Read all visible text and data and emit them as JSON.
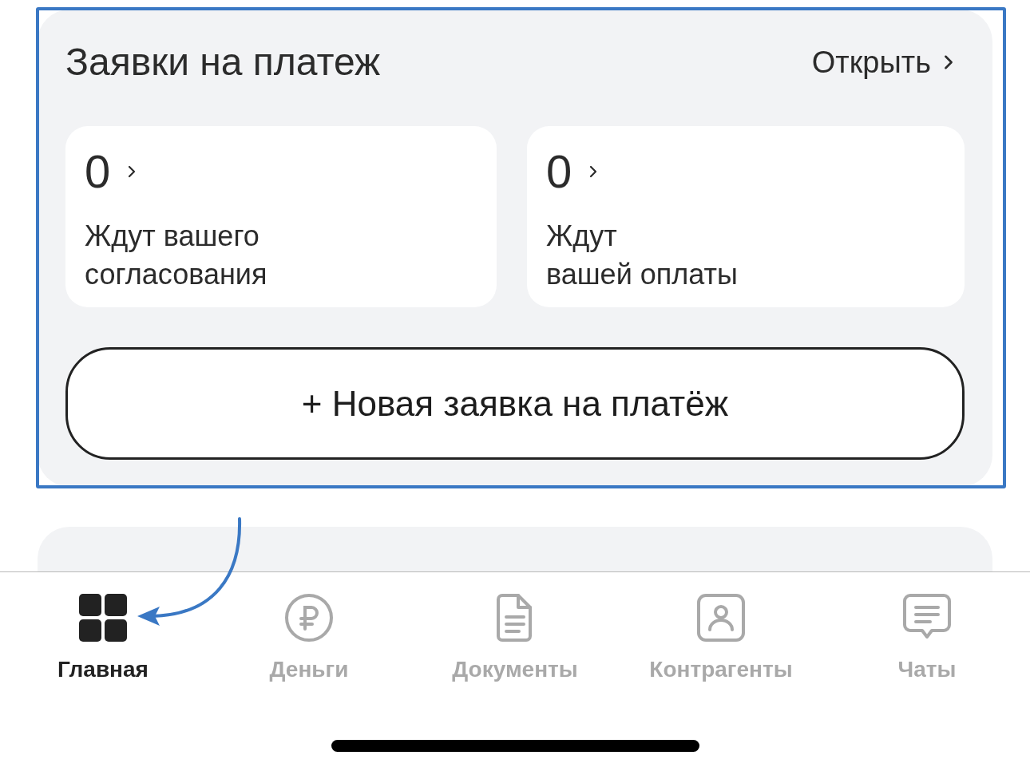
{
  "payment_requests": {
    "title": "Заявки на платеж",
    "open_link": "Открыть",
    "counters": [
      {
        "count": "0",
        "label": "Ждут вашего\nсогласования"
      },
      {
        "count": "0",
        "label": "Ждут\nвашей оплаты"
      }
    ],
    "new_button": "+ Новая заявка на платёж"
  },
  "tabs": [
    {
      "kind": "home",
      "label": "Главная",
      "selected": true
    },
    {
      "kind": "money",
      "label": "Деньги",
      "selected": false
    },
    {
      "kind": "documents",
      "label": "Документы",
      "selected": false
    },
    {
      "kind": "contacts",
      "label": "Контрагенты",
      "selected": false
    },
    {
      "kind": "chats",
      "label": "Чаты",
      "selected": false
    }
  ]
}
